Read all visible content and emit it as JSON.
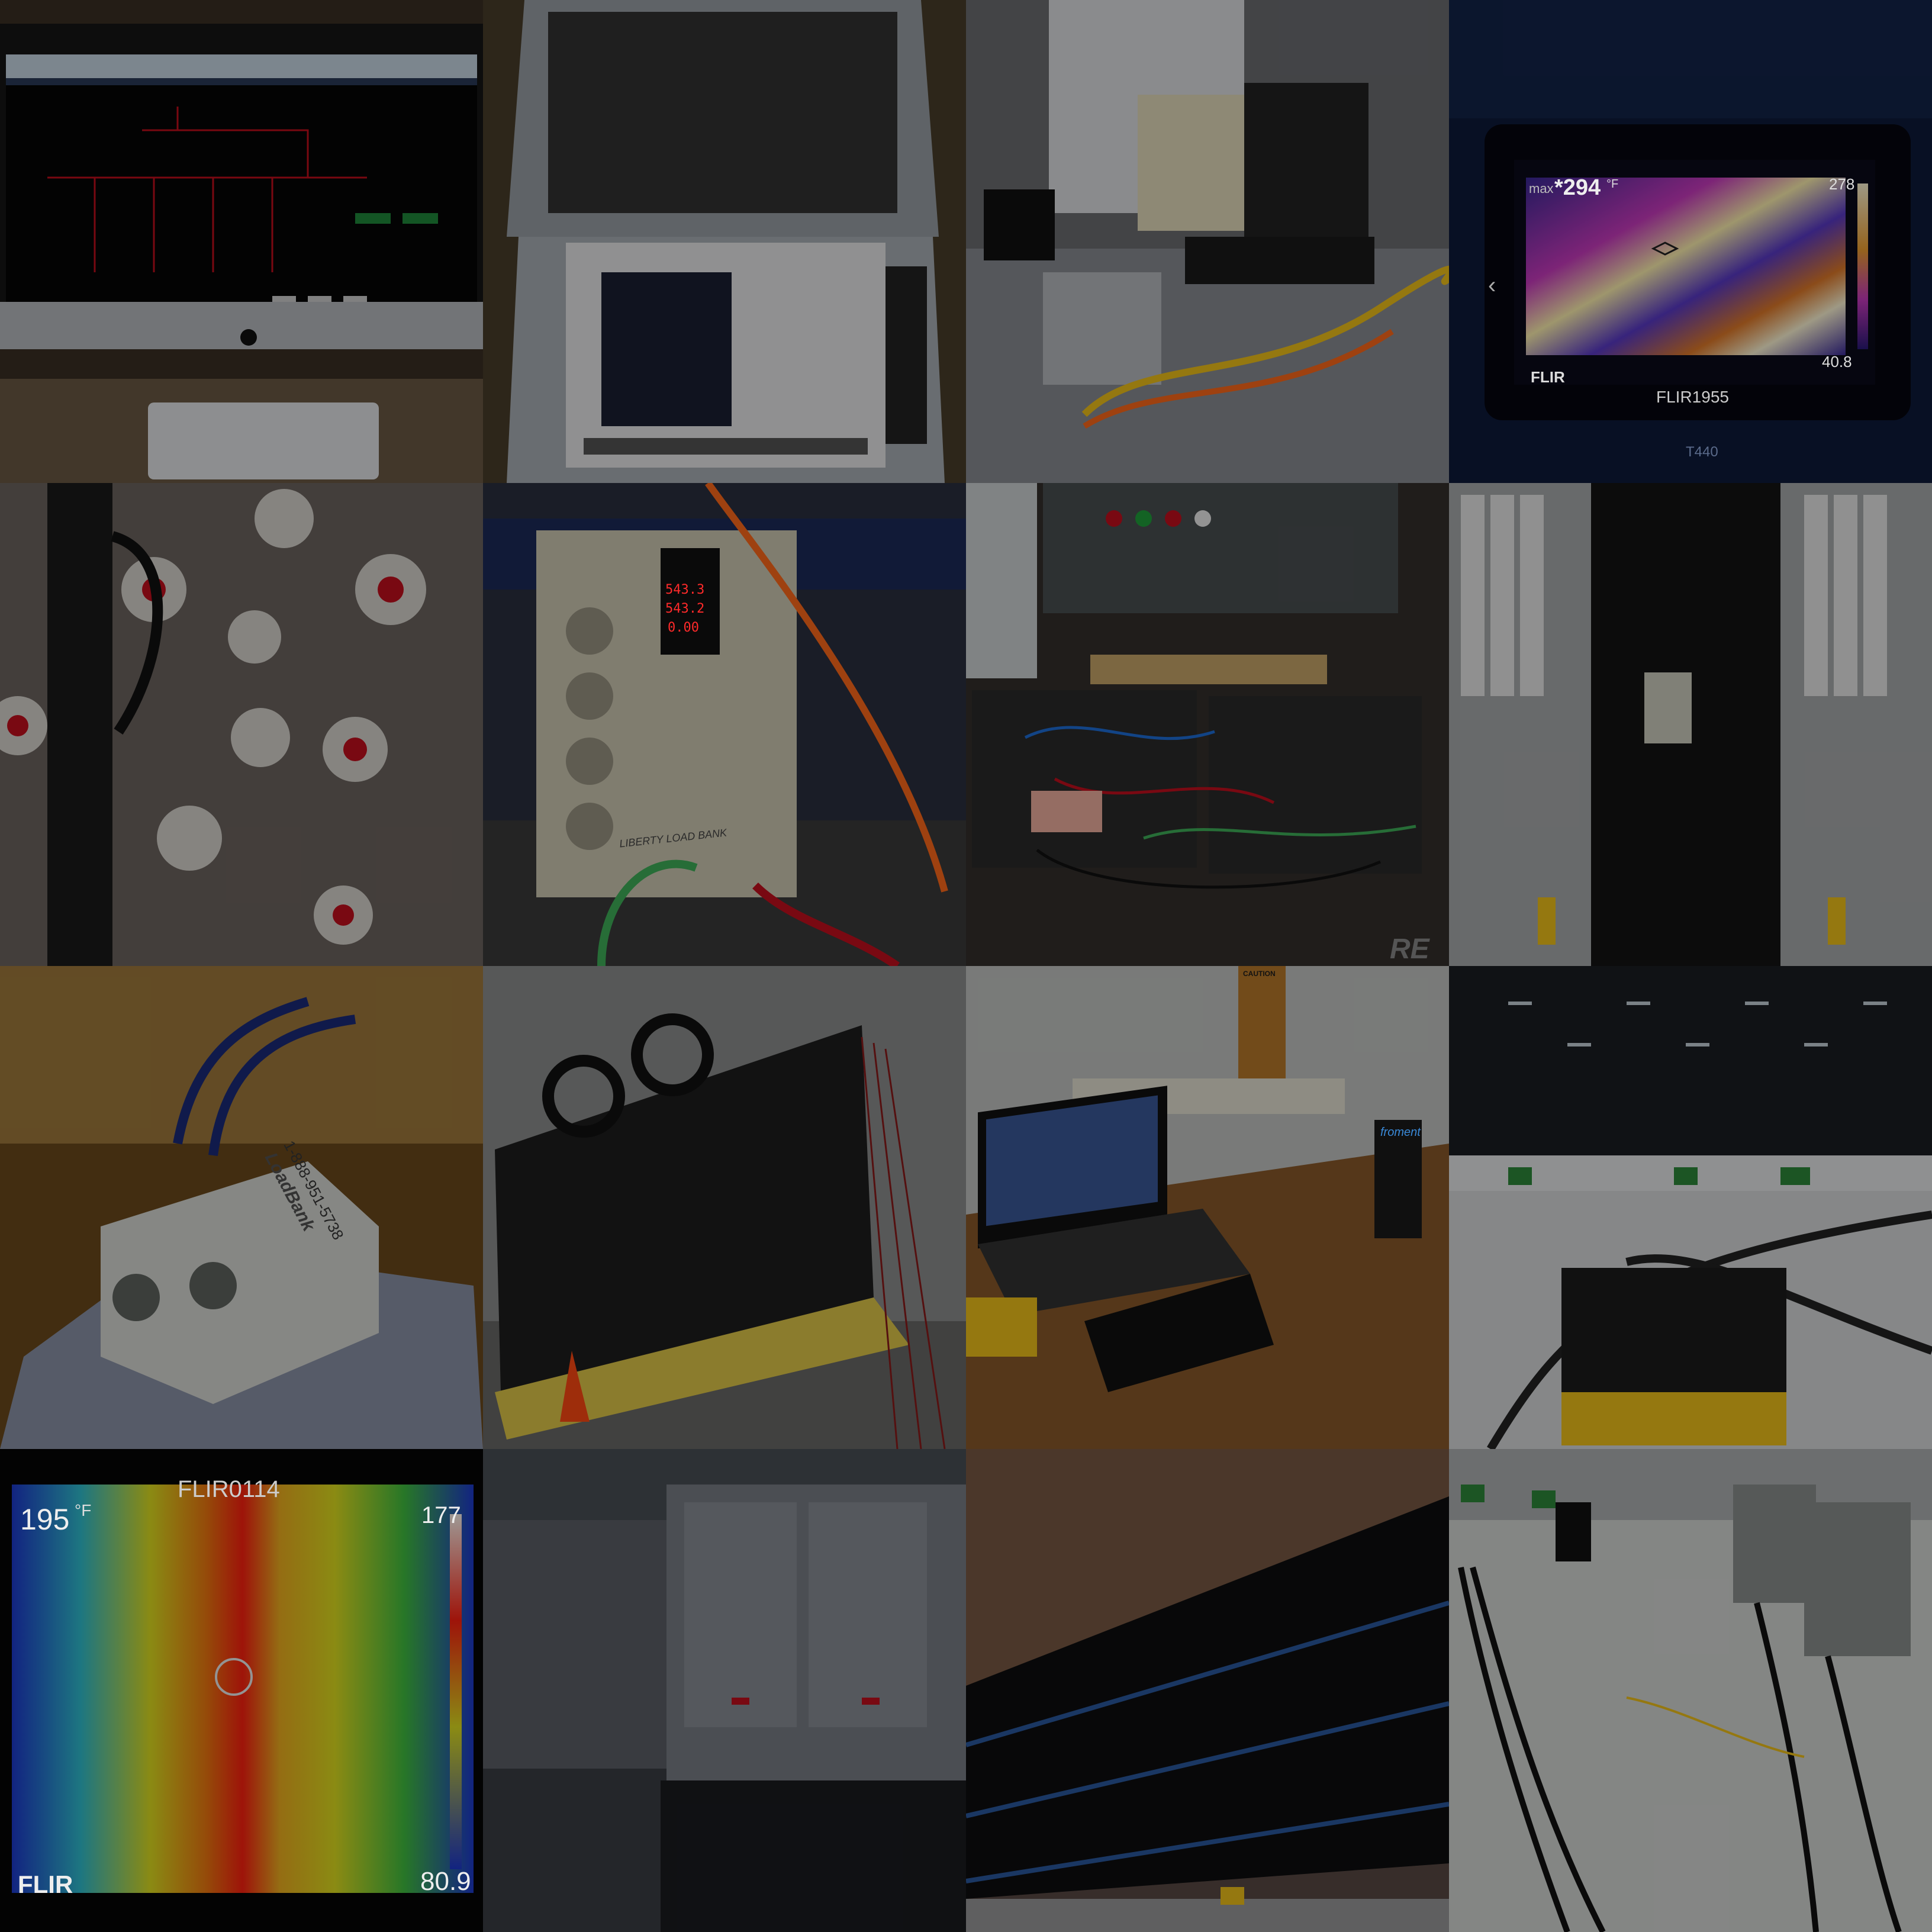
{
  "tiles": {
    "thermal_camera_top": {
      "max_label": "max",
      "max_reading": "*294",
      "unit": "°F",
      "scale_top": "278",
      "scale_bottom": "40.8",
      "brand": "FLIR",
      "file_name": "FLIR1955",
      "model": "T440"
    },
    "load_bank_meter": {
      "readout_1": "543.3",
      "readout_2": "543.2",
      "readout_3": "0.00",
      "brand_plate": "LIBERTY LOAD BANK"
    },
    "control_panel_tag": {
      "tag": "RE"
    },
    "portable_load_bank": {
      "decal": "LoadBank",
      "phone": "1-888-951-5738"
    },
    "test_desk": {
      "device_brand": "froment",
      "sign": "CAUTION"
    },
    "thermal_cables": {
      "file_name": "FLIR0114",
      "temperature": "195",
      "unit": "°F",
      "scale_top": "177",
      "scale_bottom": "80.9",
      "brand": "FLIR"
    }
  },
  "colors": {
    "flir_ui_text": "#e8e8e8",
    "meter_red": "#ff2a2a",
    "hot_white": "#fff7d6",
    "cable_yellow": "#f0c21b",
    "cable_orange": "#ff6a1a",
    "floor_grey": "#8a8d93"
  }
}
